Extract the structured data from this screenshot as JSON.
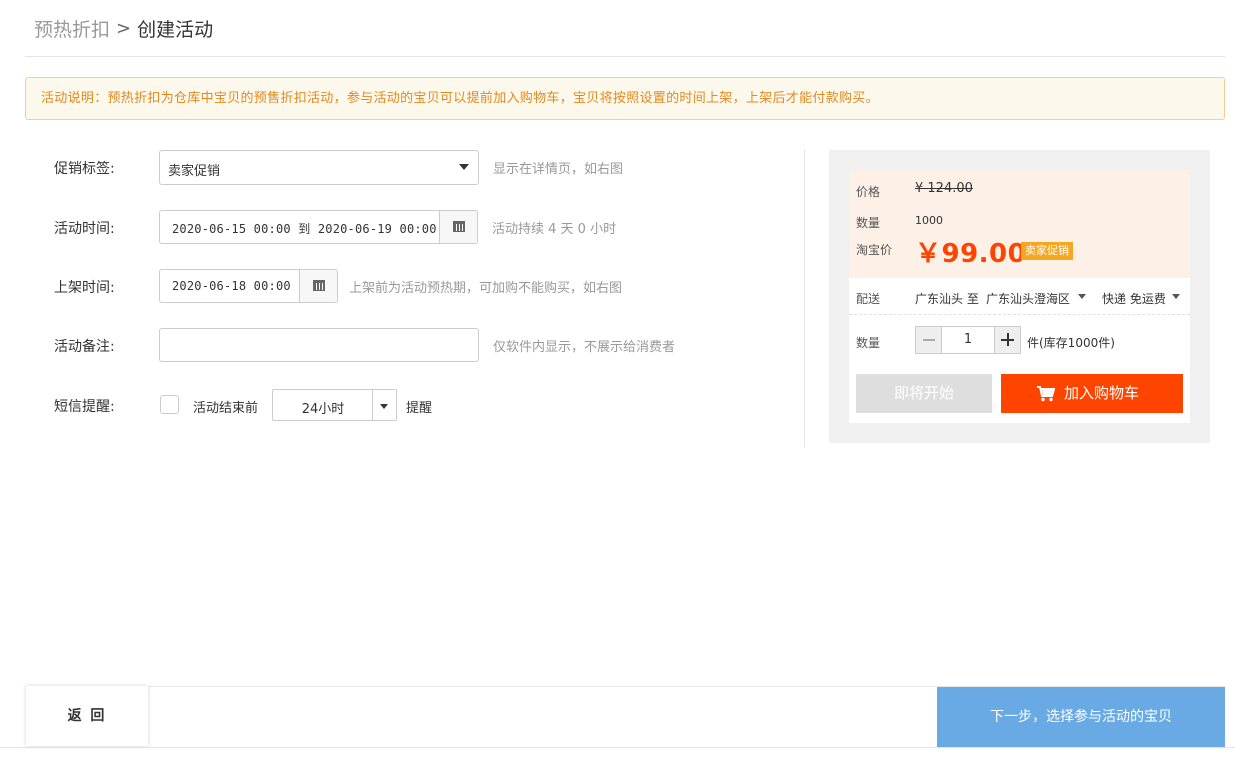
{
  "breadcrumb": {
    "parent": "预热折扣",
    "separator": ">",
    "current": "创建活动"
  },
  "notice": {
    "text": "活动说明：预热折扣为仓库中宝贝的预售折扣活动，参与活动的宝贝可以提前加入购物车，宝贝将按照设置的时间上架，上架后才能付款购买。"
  },
  "form": {
    "promo_tag": {
      "label": "促销标签:",
      "value": "卖家促销",
      "hint": "显示在详情页，如右图"
    },
    "activity_time": {
      "label": "活动时间:",
      "value": "2020-06-15 00:00 到 2020-06-19 00:00",
      "hint": "活动持续 4 天 0 小时"
    },
    "shelf_time": {
      "label": "上架时间:",
      "value": "2020-06-18 00:00",
      "hint": "上架前为活动预热期，可加购不能购买，如右图"
    },
    "remark": {
      "label": "活动备注:",
      "value": "",
      "hint": "仅软件内显示，不展示给消费者"
    },
    "sms": {
      "label": "短信提醒:",
      "checked": false,
      "before_text": "活动结束前",
      "option": "24小时",
      "after_text": "提醒"
    }
  },
  "preview": {
    "price_label": "价格",
    "original_price": "¥ 124.00",
    "stock_label": "数量",
    "stock_value": "1000",
    "taobao_label": "淘宝价",
    "promo_price": "￥99.00",
    "promo_badge": "卖家促销",
    "shipping_label": "配送",
    "shipping_from": "广东汕头 至",
    "shipping_to": "广东汕头澄海区",
    "shipping_method": "快递 免运费",
    "qty_label": "数量",
    "qty_value": "1",
    "stock_note": "件(库存1000件)",
    "soon_button": "即将开始",
    "cart_button": "加入购物车"
  },
  "footer": {
    "back_label": "返 回",
    "next_label": "下一步，选择参与活动的宝贝"
  },
  "colors": {
    "accent": "#ff4400",
    "notice_text": "#e08a1e",
    "next_button": "#6aaae4",
    "badge": "#f5a623"
  },
  "icons": [
    "chevron-right-icon",
    "caret-down-icon",
    "calendar-icon",
    "cart-icon",
    "minus-icon",
    "plus-icon"
  ]
}
